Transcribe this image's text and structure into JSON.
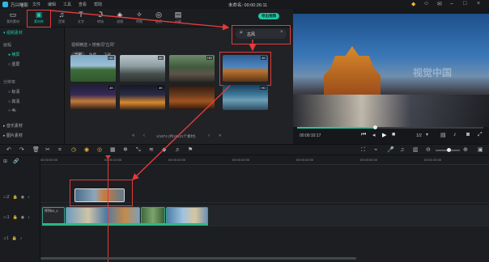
{
  "app": {
    "title": "万兴喵影",
    "menu": [
      "文件",
      "编辑",
      "工具",
      "查看",
      "帮助"
    ],
    "project": "未命名: 00:00:26:11"
  },
  "export_label": "导出视频",
  "toolbar": [
    {
      "icon": "import-icon",
      "label": "我的素材"
    },
    {
      "icon": "folder-icon",
      "label": "素材库"
    },
    {
      "icon": "music-icon",
      "label": "音频"
    },
    {
      "icon": "text-icon",
      "label": "文字"
    },
    {
      "icon": "fx-icon",
      "label": "转场"
    },
    {
      "icon": "drop-icon",
      "label": "滤镜"
    },
    {
      "icon": "sparkle-icon",
      "label": "特效"
    },
    {
      "icon": "sticker-icon",
      "label": "贴纸"
    },
    {
      "icon": "split-icon",
      "label": "分屏"
    }
  ],
  "sidebar": {
    "root": "视频素材",
    "groups": [
      {
        "title": "画幅",
        "items": [
          "横屏",
          "竖屏"
        ]
      },
      {
        "title": "分辨率",
        "items": [
          "标清",
          "高清",
          "4k"
        ]
      }
    ],
    "collapsed": [
      "音乐素材",
      "图片素材"
    ]
  },
  "media": {
    "breadcrumb": "视频精选 > 搜索词\"古风\"",
    "tabs": [
      "全部",
      "免费",
      "下载"
    ],
    "search": {
      "value": "古风",
      "placeholder": "搜索"
    },
    "pagination": "1/1874 (共18621个素材)",
    "badges": [
      "HD",
      "4K",
      "HD",
      "4K",
      "4K",
      "4K",
      "HD"
    ]
  },
  "preview": {
    "time": "00:00:10:17",
    "ratio": "1/2",
    "watermark": "视觉中国"
  },
  "timeline": {
    "ruler": [
      "00:00:00:00",
      "00:00:10:00",
      "00:00:20:00",
      "00:00:30:00",
      "00:00:40:00",
      "00:00:50:00",
      "00:01:00:00"
    ],
    "clip_label": "序列01_1"
  },
  "colors": {
    "accent": "#1fc7a7",
    "highlight": "#e23b3b",
    "bg": "#1e2024"
  }
}
